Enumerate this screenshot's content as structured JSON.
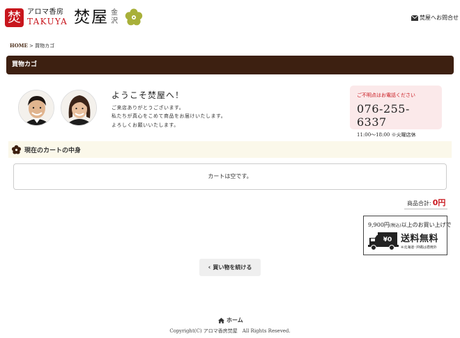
{
  "header": {
    "logo_mark": "焚",
    "logo_tagline": "アロマ香房",
    "logo_english": "TAKUYA",
    "logo_kanji": "焚屋",
    "logo_city": "金沢",
    "contact_label": "焚屋へお問合せ"
  },
  "breadcrumb": {
    "home": "HOME",
    "separator": " > ",
    "current": "買物カゴ"
  },
  "page_title": "買物カゴ",
  "welcome": {
    "title": "ようこそ焚屋へ！",
    "line1": "ご来店ありがとうございます。",
    "line2": "私たちが真心をこめて商品をお届けいたします。",
    "line3": "よろしくお願いいたします。"
  },
  "phone": {
    "label": "ご不明点はお電話ください",
    "number": "076-255-6337",
    "hours": "11:00〜18:00 ※火曜店休"
  },
  "cart": {
    "heading": "現在のカートの中身",
    "empty_message": "カートは空です。",
    "total_label": "商品合計:",
    "total_value": "0円"
  },
  "free_shipping": {
    "threshold": "9,900",
    "unit": "円",
    "tax_note": "(税込)",
    "condition": "以上のお買い上げで",
    "yen_badge": "¥0",
    "main_text": "送料無料",
    "exclusion": "※北海道･沖縄は適用外"
  },
  "continue_button": "買い物を続ける",
  "footer": {
    "home": "ホーム",
    "copyright": "Copyright(C) アロマ香房焚屋　All Rights Reseved."
  },
  "colors": {
    "brand_red": "#c8161d",
    "title_bar": "#3d2011",
    "phone_box": "#fbe9ea",
    "cart_heading_bg": "#fbf8ea",
    "flower_green": "#a8b03a"
  }
}
